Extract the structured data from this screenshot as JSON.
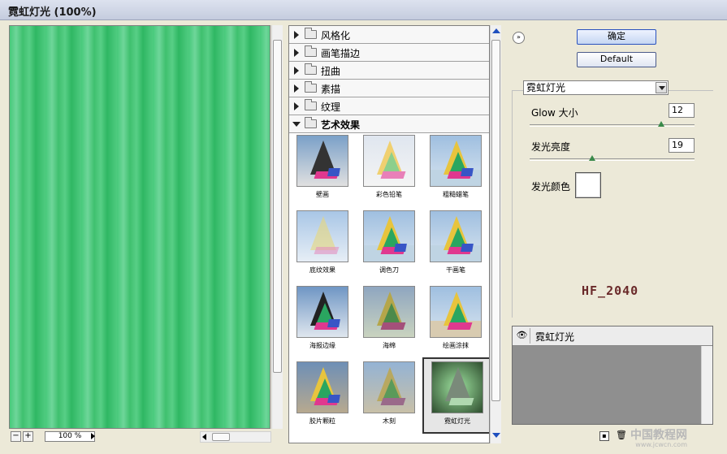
{
  "window": {
    "title": "霓虹灯光 (100%)"
  },
  "zoom": {
    "minus": "−",
    "plus": "+",
    "value": "100 %"
  },
  "categories": [
    {
      "label": "风格化",
      "open": false
    },
    {
      "label": "画笔描边",
      "open": false
    },
    {
      "label": "扭曲",
      "open": false
    },
    {
      "label": "素描",
      "open": false
    },
    {
      "label": "纹理",
      "open": false
    },
    {
      "label": "艺术效果",
      "open": true
    }
  ],
  "filters": [
    {
      "name": "壁画"
    },
    {
      "name": "彩色铅笔"
    },
    {
      "name": "粗糙蜡笔"
    },
    {
      "name": "底纹效果"
    },
    {
      "name": "调色刀"
    },
    {
      "name": "干画笔"
    },
    {
      "name": "海报边缘"
    },
    {
      "name": "海绵"
    },
    {
      "name": "绘画涂抹"
    },
    {
      "name": "胶片颗粒"
    },
    {
      "name": "木刻"
    },
    {
      "name": "霓虹灯光",
      "selected": true
    }
  ],
  "buttons": {
    "ok": "确定",
    "default": "Default",
    "collapse": "»"
  },
  "options": {
    "filter_select": "霓虹灯光",
    "glow_size_label": "Glow 大小",
    "glow_size_value": "12",
    "glow_size_level": 0.8,
    "glow_brightness_label": "发光亮度",
    "glow_brightness_value": "19",
    "glow_brightness_level": 0.38,
    "glow_color_label": "发光颜色",
    "glow_color": "#ffffff"
  },
  "watermark": "HF_2040",
  "layers": {
    "active": "霓虹灯光",
    "eye": "👁"
  },
  "footer_icons": {
    "new": "new-layer-icon",
    "delete": "trash-icon"
  },
  "logo": {
    "text": "中国教程网",
    "url_text": "www.jcwcn.com"
  },
  "colors": {
    "preview_green": "#47c97a",
    "accent": "#2a52be"
  }
}
